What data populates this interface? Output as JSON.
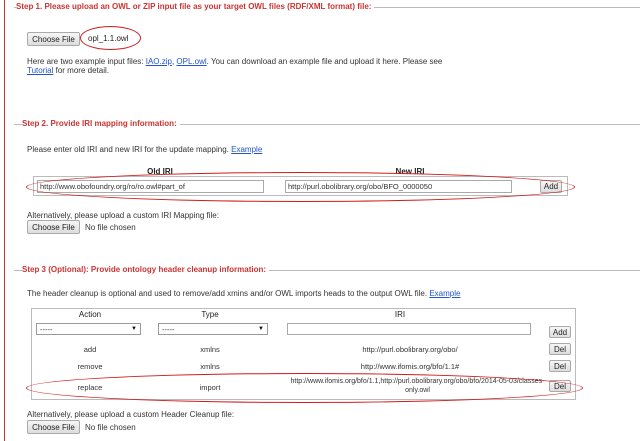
{
  "step1": {
    "title": "Step 1. Please upload an OWL or ZIP input file as your target OWL files (RDF/XML format) file:",
    "choose_file_label": "Choose File",
    "file_name": "opl_1.1.owl",
    "examples_prefix": "Here are two example input files: ",
    "example1": "IAO.zip",
    "sep": ", ",
    "example2": "OPL.owl",
    "examples_suffix": ". You can download an example file and upload it here. Please see",
    "tutorial": "Tutorial",
    "tutorial_suffix": " for more detail."
  },
  "step2": {
    "title": "Step 2. Provide IRI mapping information:",
    "instruction": "Please enter old IRI and new IRI for the update mapping.",
    "example_link": "Example",
    "col_old": "Old IRI",
    "col_new": "New IRI",
    "old_iri_value": "http://www.obofoundry.org/ro/ro.owl#part_of",
    "new_iri_value": "http://purl.obolibrary.org/obo/BFO_0000050",
    "add_label": "Add",
    "alt_upload": "Alternatively, please upload a custom IRI Mapping file:",
    "choose_file_label": "Choose File",
    "no_file": "No file chosen"
  },
  "step3": {
    "title": "Step 3 (Optional): Provide ontology header cleanup information:",
    "instruction": "The header cleanup is optional and used to remove/add xmins and/or OWL imports heads to the output OWL file.",
    "example_link": "Example",
    "col_action": "Action",
    "col_type": "Type",
    "col_iri": "IRI",
    "action_select": "-----",
    "type_select": "-----",
    "add_label": "Add",
    "rows": [
      {
        "action": "add",
        "type": "xmlns",
        "iri": "http://purl.obolibrary.org/obo/",
        "del": "Del"
      },
      {
        "action": "remove",
        "type": "xmlns",
        "iri": "http://www.ifomis.org/bfo/1.1#",
        "del": "Del"
      },
      {
        "action": "replace",
        "type": "import",
        "iri": "http://www.ifomis.org/bfo/1.1,http://purl.obolibrary.org/obo/bfo/2014-05-03/classes-only.owl",
        "del": "Del"
      }
    ],
    "alt_upload": "Alternatively, please upload a custom Header Cleanup file:",
    "choose_file_label": "Choose File",
    "no_file": "No file chosen"
  },
  "colors": {
    "accent": "#cc3333",
    "link": "#2255cc",
    "highlight": "#d01c1c"
  },
  "icons": {
    "select_arrow": "chevron-down-icon"
  }
}
